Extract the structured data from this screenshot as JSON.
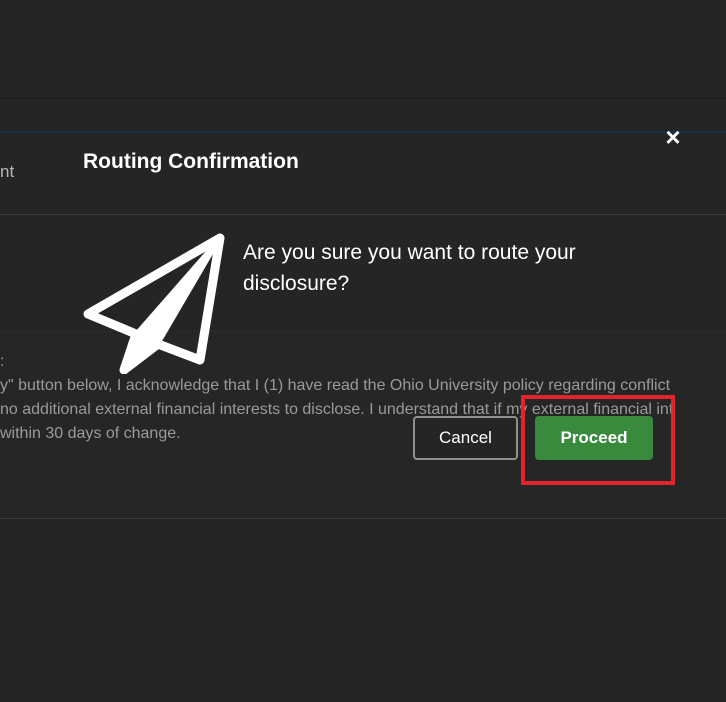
{
  "background": {
    "column_label": "nt",
    "text_lines": [
      ":",
      "y\" button below, I acknowledge that I (1) have read the Ohio University policy regarding conflict",
      "no additional external financial interests to disclose.  I understand that if my external financial int",
      "within 30 days of change."
    ]
  },
  "modal": {
    "title": "Routing Confirmation",
    "close_icon": "×",
    "message": "Are you sure you want to route your disclosure?",
    "icon": "paper-plane-icon",
    "cancel_label": "Cancel",
    "proceed_label": "Proceed"
  },
  "colors": {
    "proceed": "#3a8a3e",
    "highlight": "#e0262b",
    "background": "#252525"
  }
}
